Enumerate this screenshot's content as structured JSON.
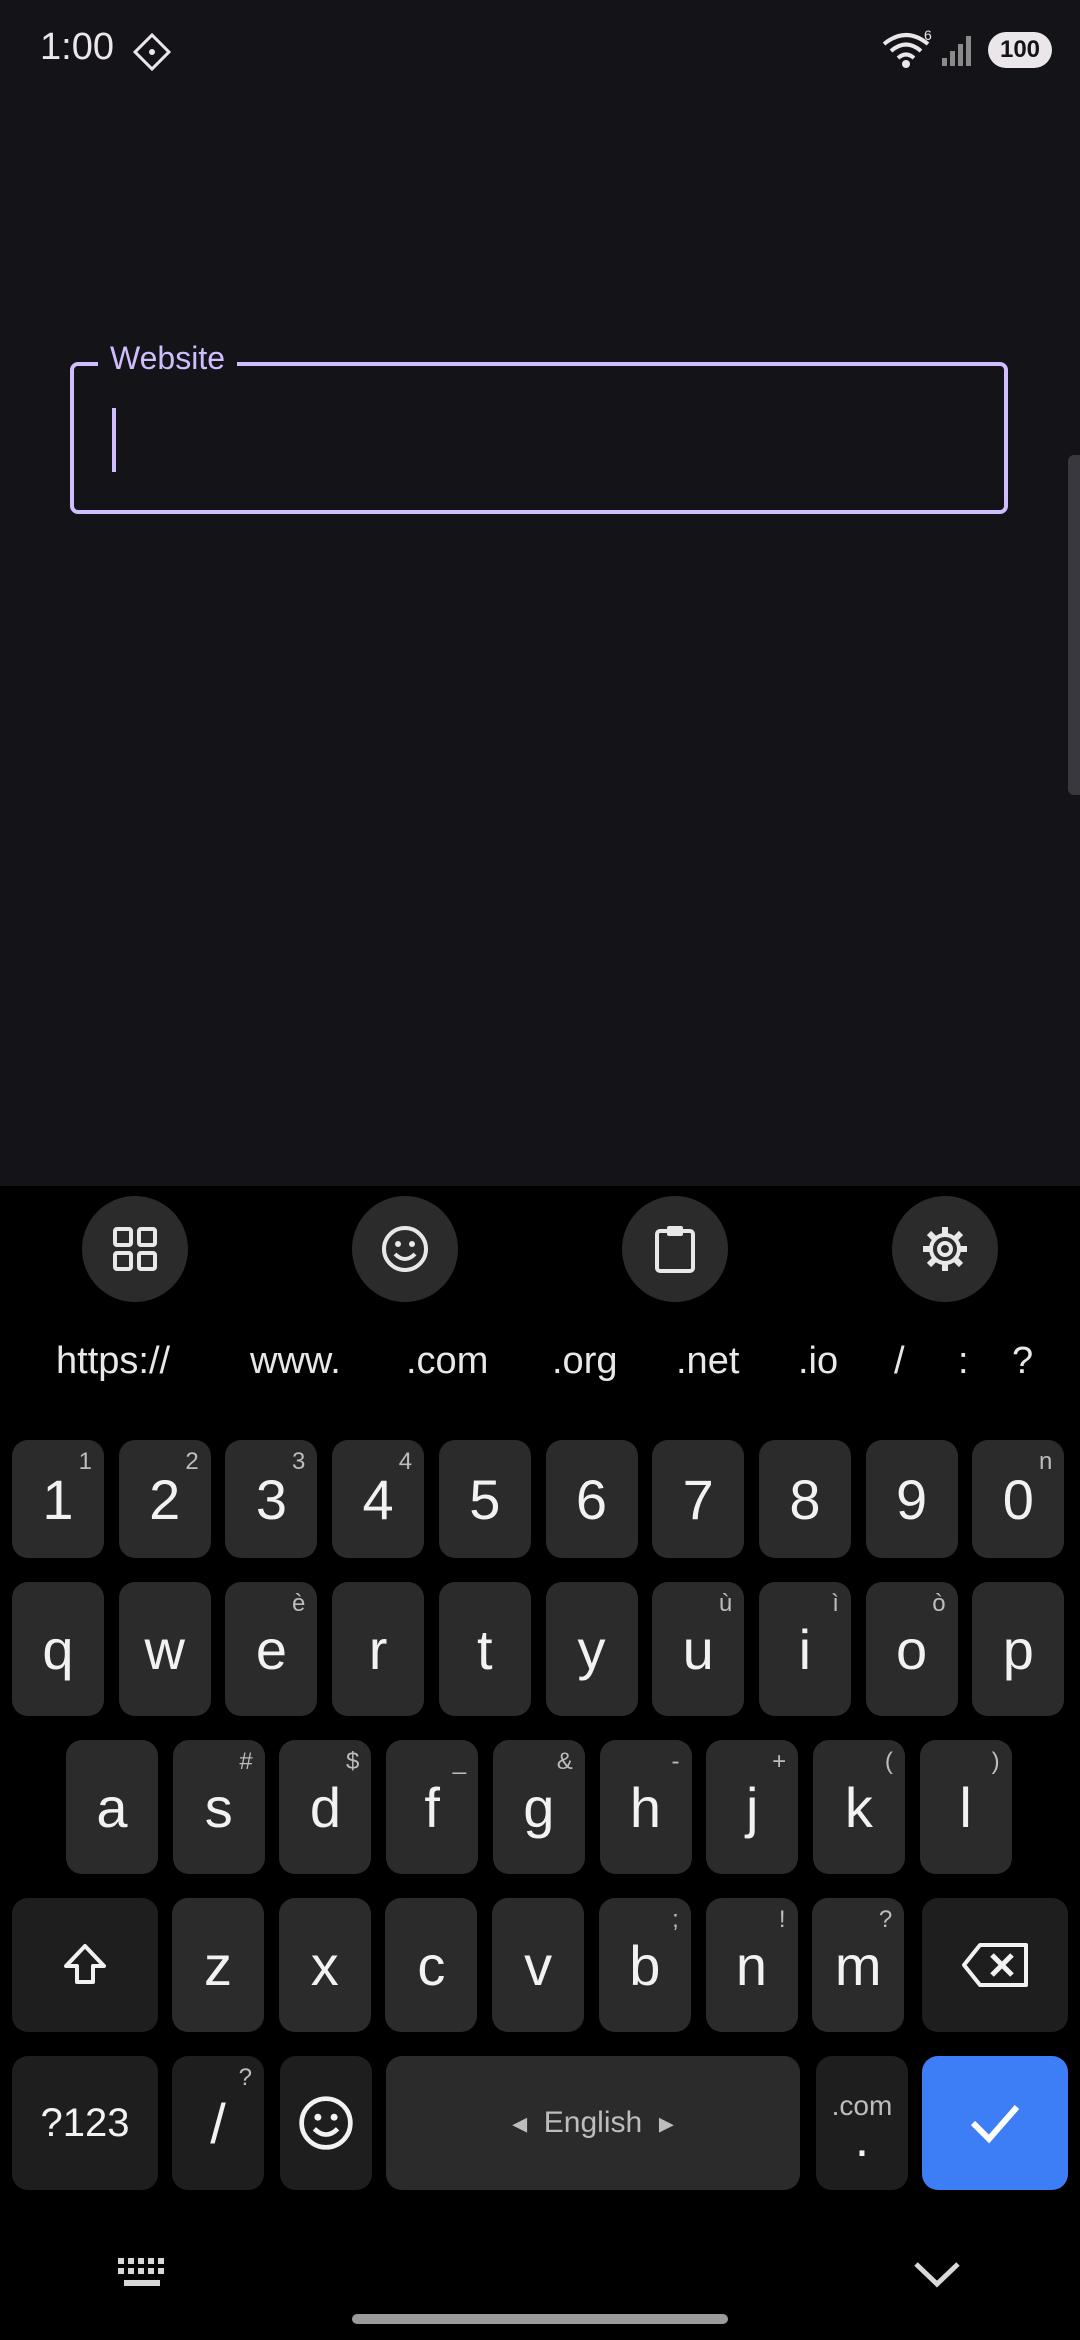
{
  "status": {
    "time": "1:00",
    "wifi_label": "6",
    "battery": "100"
  },
  "field": {
    "label": "Website",
    "value": ""
  },
  "toolbar": {
    "icons": [
      "grid-icon",
      "emoji-icon",
      "clipboard-icon",
      "settings-icon"
    ]
  },
  "suggestions": [
    "https://",
    "www.",
    ".com",
    ".org",
    ".net",
    ".io",
    "/",
    ":",
    "?"
  ],
  "keys": {
    "row_numbers": [
      {
        "k": "1",
        "h": "1"
      },
      {
        "k": "2",
        "h": "2"
      },
      {
        "k": "3",
        "h": "3"
      },
      {
        "k": "4",
        "h": "4"
      },
      {
        "k": "5",
        "h": ""
      },
      {
        "k": "6",
        "h": ""
      },
      {
        "k": "7",
        "h": ""
      },
      {
        "k": "8",
        "h": ""
      },
      {
        "k": "9",
        "h": ""
      },
      {
        "k": "0",
        "h": "n"
      }
    ],
    "row1": [
      {
        "k": "q",
        "h": ""
      },
      {
        "k": "w",
        "h": ""
      },
      {
        "k": "e",
        "h": "è"
      },
      {
        "k": "r",
        "h": ""
      },
      {
        "k": "t",
        "h": ""
      },
      {
        "k": "y",
        "h": ""
      },
      {
        "k": "u",
        "h": "ù"
      },
      {
        "k": "i",
        "h": "ì"
      },
      {
        "k": "o",
        "h": "ò"
      },
      {
        "k": "p",
        "h": ""
      }
    ],
    "row2": [
      {
        "k": "a",
        "h": ""
      },
      {
        "k": "s",
        "h": "#"
      },
      {
        "k": "d",
        "h": "$"
      },
      {
        "k": "f",
        "h": "_"
      },
      {
        "k": "g",
        "h": "&"
      },
      {
        "k": "h",
        "h": "-"
      },
      {
        "k": "j",
        "h": "+"
      },
      {
        "k": "k",
        "h": "("
      },
      {
        "k": "l",
        "h": ")"
      }
    ],
    "row3": [
      {
        "k": "z",
        "h": ""
      },
      {
        "k": "x",
        "h": ""
      },
      {
        "k": "c",
        "h": ""
      },
      {
        "k": "v",
        "h": ""
      },
      {
        "k": "b",
        "h": ";"
      },
      {
        "k": "n",
        "h": "!"
      },
      {
        "k": "m",
        "h": "?"
      }
    ],
    "symbols": "?123",
    "slash": "/",
    "slash_hint": "?",
    "space": "English",
    "dotcom_top": ".com",
    "dotcom_bottom": "."
  },
  "colors": {
    "accent": "#cfbdfe",
    "enter": "#3d7ef6",
    "background": "#141318"
  }
}
